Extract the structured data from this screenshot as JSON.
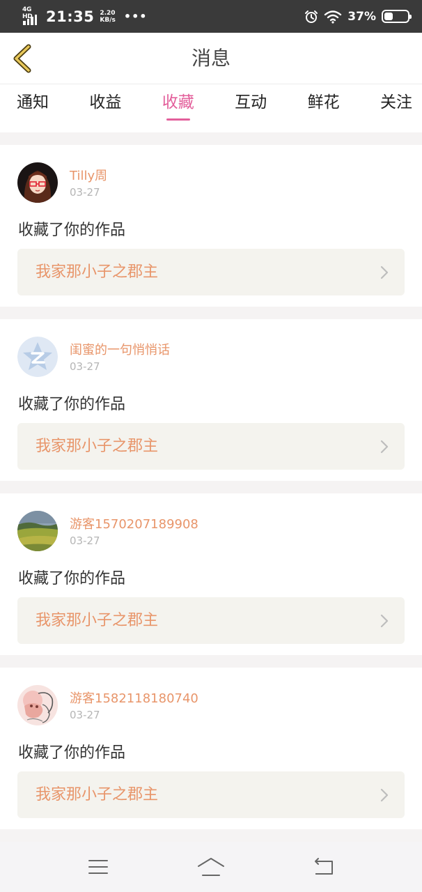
{
  "status_bar": {
    "network": "4G HD",
    "time": "21:35",
    "speed_value": "2.20",
    "speed_unit": "KB/s",
    "more": "•••",
    "battery_percent": "37%",
    "battery_level": 0.37
  },
  "header": {
    "title": "消息"
  },
  "tabs": [
    {
      "label": "通知",
      "active": false
    },
    {
      "label": "收益",
      "active": false
    },
    {
      "label": "收藏",
      "active": true
    },
    {
      "label": "互动",
      "active": false
    },
    {
      "label": "鲜花",
      "active": false
    },
    {
      "label": "关注",
      "active": false
    }
  ],
  "notifications": [
    {
      "username": "Tilly周",
      "date": "03-27",
      "action": "收藏了你的作品",
      "work_title": "我家那小子之郡主",
      "avatar": "cartoon-girl-avatar"
    },
    {
      "username": "闺蜜的一句悄悄话",
      "date": "03-27",
      "action": "收藏了你的作品",
      "work_title": "我家那小子之郡主",
      "avatar": "default-star-avatar"
    },
    {
      "username": "游客1570207189908",
      "date": "03-27",
      "action": "收藏了你的作品",
      "work_title": "我家那小子之郡主",
      "avatar": "landscape-avatar"
    },
    {
      "username": "游客1582118180740",
      "date": "03-27",
      "action": "收藏了你的作品",
      "work_title": "我家那小子之郡主",
      "avatar": "sketch-avatar"
    }
  ],
  "colors": {
    "accent": "#e35f9b",
    "username": "#e8956a",
    "back_arrow": "#d9b84b"
  },
  "bottom_nav": {
    "icons": [
      "menu-icon",
      "home-icon",
      "back-icon"
    ]
  }
}
